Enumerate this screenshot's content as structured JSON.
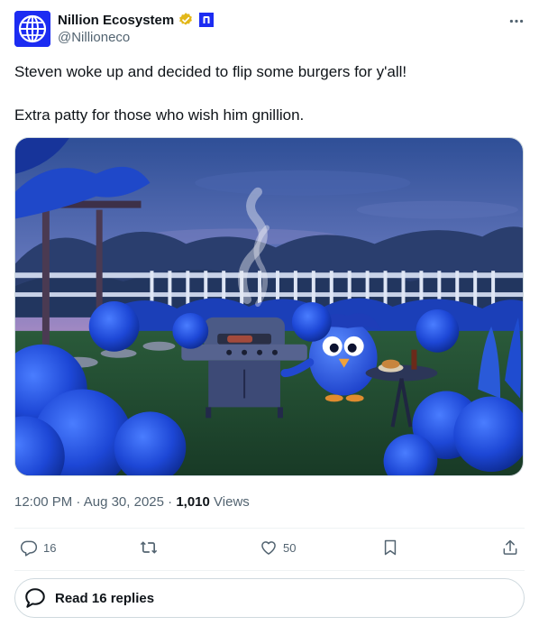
{
  "author": {
    "display_name": "Nillion Ecosystem",
    "handle": "@Nillioneco",
    "avatar_icon": "nillion-globe-logo",
    "verified_icon": "gold-verified-badge",
    "affiliation_icon": "nillion-n-badge"
  },
  "post": {
    "lines": [
      "Steven woke up and decided to flip some burgers for y'all!",
      "Extra patty for those who wish him gnillion."
    ],
    "image_alt": "Blue owl mascot grilling burgers in a garden of blue hydrangeas at dusk"
  },
  "meta": {
    "time": "12:00 PM",
    "separator": "·",
    "date": "Aug 30, 2025",
    "views_count": "1,010",
    "views_label": "Views"
  },
  "actions": {
    "replies": "16",
    "reposts": "",
    "likes": "50"
  },
  "replies_button": {
    "label": "Read 16 replies"
  },
  "colors": {
    "brand_blue": "#1c2cf2",
    "verified_gold": "#e2b719",
    "text_primary": "#0f1419",
    "text_secondary": "#536471",
    "border": "#cfd9de"
  }
}
